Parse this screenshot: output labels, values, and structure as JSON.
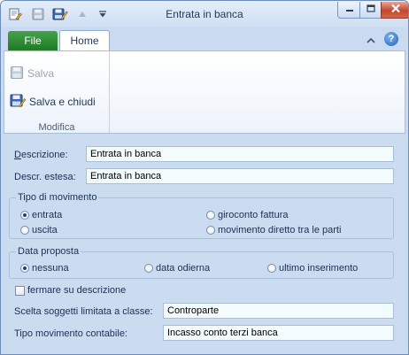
{
  "window": {
    "title": "Entrata in banca"
  },
  "ribbon": {
    "tabs": {
      "file": "File",
      "home": "Home"
    },
    "group": {
      "label": "Modifica",
      "salva": "Salva",
      "salva_chiudi": "Salva e chiudi"
    }
  },
  "form": {
    "descrizione": {
      "label": "Descrizione:",
      "value": "Entrata in banca"
    },
    "descr_estesa": {
      "label": "Descr. estesa:",
      "value": "Entrata in banca"
    },
    "tipo_movimento": {
      "title": "Tipo di movimento",
      "options": [
        "entrata",
        "uscita",
        "giroconto fattura",
        "movimento diretto tra le parti"
      ],
      "selected": "entrata"
    },
    "data_proposta": {
      "title": "Data proposta",
      "options": [
        "nessuna",
        "data odierna",
        "ultimo inserimento"
      ],
      "selected": "nessuna"
    },
    "fermare": {
      "label": "fermare su descrizione",
      "checked": false
    },
    "scelta_soggetti": {
      "label": "Scelta soggetti limitata a classe:",
      "value": "Controparte"
    },
    "tipo_contabile": {
      "label": "Tipo movimento contabile:",
      "value": "Incasso conto terzi banca"
    }
  },
  "icons": {
    "app": "document-edit-icon",
    "save": "floppy-disk-icon",
    "save_close": "floppy-disk-pen-icon",
    "up": "arrow-up-icon",
    "customize": "dropdown-arrow-icon",
    "minimize": "minimize-icon",
    "maximize": "maximize-icon",
    "close": "close-icon",
    "collapse": "chevron-up-icon",
    "help": "help-icon"
  },
  "colors": {
    "window_bg": "#c9daf1",
    "file_tab": "#2e8b33",
    "close_button": "#c3462b",
    "field_bg": "#f4fbfd"
  }
}
